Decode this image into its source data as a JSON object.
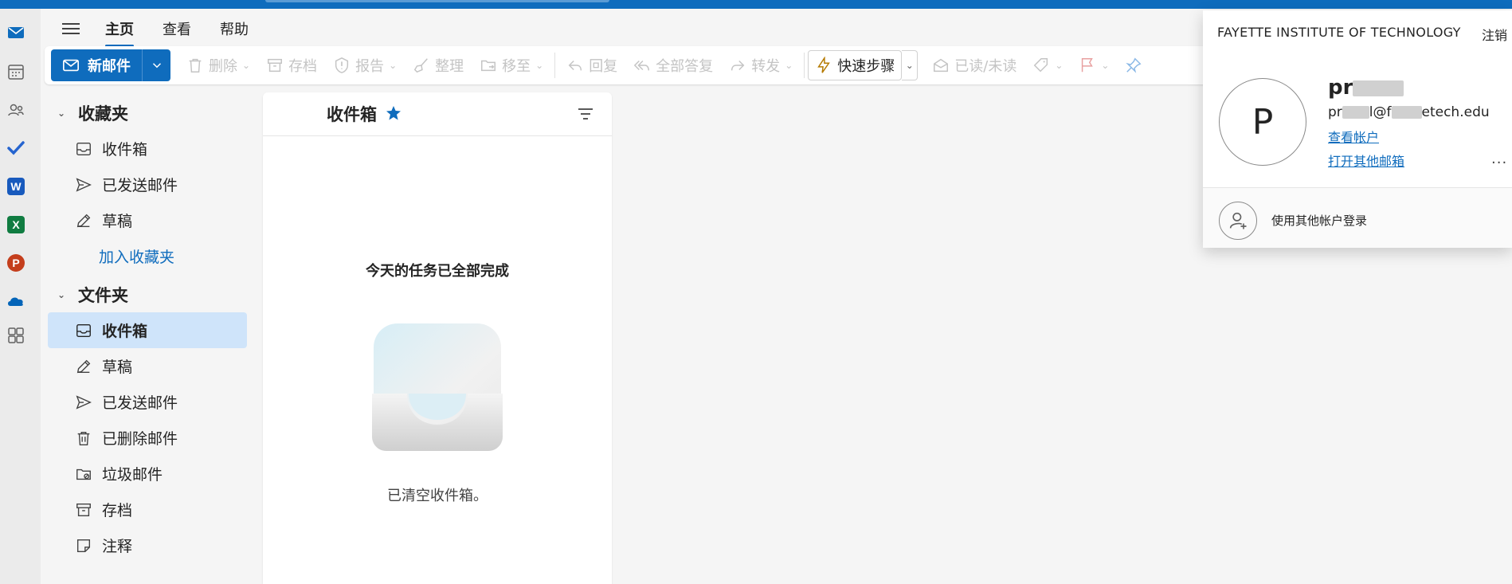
{
  "app": {
    "tabs": [
      {
        "label": "主页"
      },
      {
        "label": "查看"
      },
      {
        "label": "帮助"
      }
    ]
  },
  "ribbon": {
    "new_mail": "新邮件",
    "delete": "删除",
    "archive": "存档",
    "report": "报告",
    "sweep": "整理",
    "move_to": "移至",
    "reply": "回复",
    "reply_all": "全部答复",
    "forward": "转发",
    "quick_steps": "快速步骤",
    "read_unread": "已读/未读"
  },
  "favorites": {
    "header": "收藏夹",
    "items": [
      {
        "label": "收件箱"
      },
      {
        "label": "已发送邮件"
      },
      {
        "label": "草稿"
      }
    ],
    "add_label": "加入收藏夹"
  },
  "folders": {
    "header": "文件夹",
    "items": [
      {
        "label": "收件箱"
      },
      {
        "label": "草稿"
      },
      {
        "label": "已发送邮件"
      },
      {
        "label": "已删除邮件"
      },
      {
        "label": "垃圾邮件"
      },
      {
        "label": "存档"
      },
      {
        "label": "注释"
      }
    ]
  },
  "message_list": {
    "title": "收件箱",
    "empty_title": "今天的任务已全部完成",
    "empty_subtitle": "已清空收件箱。"
  },
  "account": {
    "org": "FAYETTE INSTITUTE OF TECHNOLOGY",
    "sign_out": "注销",
    "avatar_initial": "P",
    "name_prefix": "pr",
    "email_prefix": "pr",
    "email_mid": "l@f",
    "email_suffix": "etech.edu",
    "view_account": "查看帐户",
    "open_other_mailbox": "打开其他邮箱",
    "more": "...",
    "sign_in_other": "使用其他帐户登录"
  },
  "colors": {
    "accent": "#0f6cbd",
    "selected": "#cfe4fa"
  }
}
